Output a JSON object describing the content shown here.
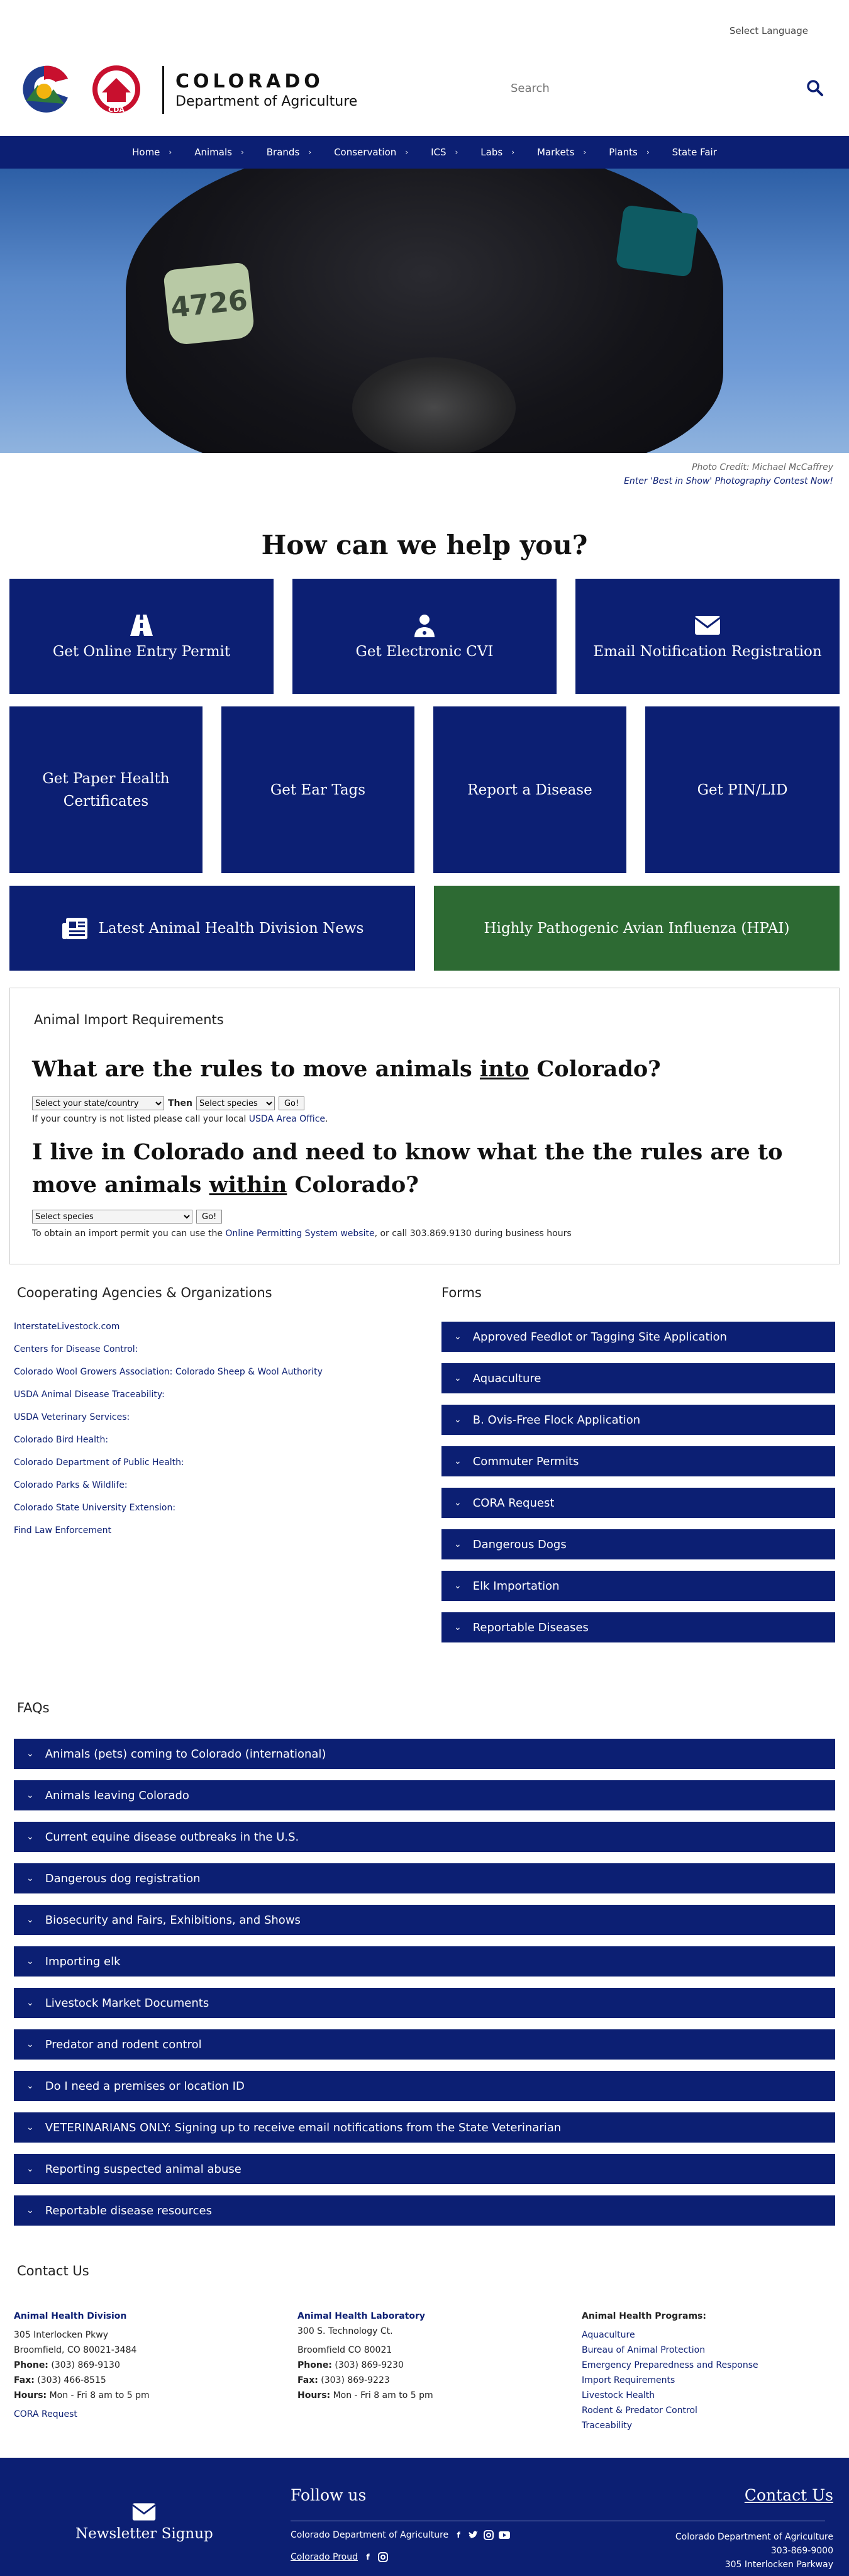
{
  "header": {
    "language": "Select Language",
    "logo_title": "COLORADO",
    "logo_sub": "Department of Agriculture",
    "logo_cda": "CDA",
    "search_placeholder": "Search"
  },
  "nav": [
    "Home",
    "Animals",
    "Brands",
    "Conservation",
    "ICS",
    "Labs",
    "Markets",
    "Plants",
    "State Fair"
  ],
  "hero": {
    "ear_tag": "4726",
    "credit": "Photo Credit: Michael McCaffrey",
    "contest_link": "Enter 'Best in Show' Photography Contest Now!"
  },
  "help_title": "How can we help you?",
  "tiles": {
    "entry_permit": "Get Online Entry Permit",
    "cvi": "Get Electronic CVI",
    "email": "Email Notification Registration",
    "paper": "Get Paper Health Certificates",
    "ear_tags": "Get Ear Tags",
    "report": "Report a Disease",
    "pin": "Get PIN/LID",
    "news": "Latest Animal Health Division News",
    "hpai": "Highly Pathogenic Avian Influenza (HPAI)"
  },
  "colors": {
    "navy": "#0c1f73",
    "green": "#2d6a33"
  },
  "import": {
    "heading": "Animal Import Requirements",
    "q1_pre": "What are the rules to move animals ",
    "q1_u": "into",
    "q1_post": " Colorado?",
    "state_select": "Select your state/country",
    "then": "Then",
    "species_select": "Select species",
    "go": "Go!",
    "note1_pre": "If your country is not listed please call your local ",
    "note1_link": "USDA Area Office",
    "note1_post": ".",
    "q2_pre": "I live in Colorado and need to know what the the rules are to move animals ",
    "q2_u": "within",
    "q2_post": " Colorado?",
    "note2_pre": "To obtain an import permit you can use the ",
    "note2_link": "Online Permitting System website",
    "note2_post": ", or call 303.869.9130 during business hours"
  },
  "agencies": {
    "heading": "Cooperating Agencies & Organizations",
    "links": [
      "InterstateLivestock.com",
      "Centers for Disease Control:",
      "Colorado Wool Growers Association: Colorado Sheep & Wool Authority",
      "USDA Animal Disease Traceability:",
      "USDA Veterinary Services:",
      "Colorado Bird Health:",
      "Colorado Department of Public Health:",
      "Colorado Parks & Wildlife:",
      "Colorado State University Extension:",
      "Find Law Enforcement"
    ]
  },
  "forms": {
    "heading": "Forms",
    "items": [
      "Approved Feedlot or Tagging Site Application",
      "Aquaculture",
      "B. Ovis-Free Flock Application",
      "Commuter Permits",
      "CORA Request",
      "Dangerous Dogs",
      "Elk Importation",
      "Reportable Diseases"
    ]
  },
  "faqs": {
    "heading": "FAQs",
    "items": [
      "Animals (pets) coming to Colorado (international)",
      "Animals leaving Colorado",
      "Current equine disease outbreaks in the U.S.",
      "Dangerous dog registration",
      "Biosecurity and Fairs, Exhibitions, and Shows",
      "Importing elk",
      "Livestock Market Documents",
      "Predator and rodent control",
      "Do I need a premises or location ID",
      "VETERINARIANS ONLY: Signing up to receive email notifications from the State Veterinarian",
      "Reporting suspected animal abuse",
      "Reportable disease resources"
    ]
  },
  "contact": {
    "heading": "Contact Us",
    "division": {
      "name": "Animal Health Division",
      "addr1": "305 Interlocken Pkwy",
      "addr2": "Broomfield, CO 80021-3484",
      "phone_label": "Phone:",
      "phone": "(303) 869-9130",
      "fax_label": "Fax:",
      "fax": "(303) 466-8515",
      "hours_label": "Hours:",
      "hours": "Mon - Fri 8 am to 5 pm",
      "cora": "CORA Request"
    },
    "lab": {
      "name": "Animal Health Laboratory",
      "addr1": "300 S. Technology Ct.",
      "addr2": "Broomfield CO 80021",
      "phone_label": "Phone:",
      "phone": "(303) 869-9230",
      "fax_label": "Fax:",
      "fax": "(303) 869-9223",
      "hours_label": "Hours:",
      "hours": "Mon - Fri 8 am to 5 pm"
    },
    "programs": {
      "heading": "Animal Health Programs:",
      "links": [
        "Aquaculture",
        "Bureau of Animal Protection",
        "Emergency Preparedness and Response",
        "Import Requirements",
        "Livestock Health",
        "Rodent & Predator Control",
        "Traceability"
      ]
    }
  },
  "footer": {
    "newsletter": "Newsletter Signup",
    "follow": "Follow us",
    "cda": "Colorado Department of Agriculture",
    "proud": "Colorado Proud",
    "contact_link": "Contact Us",
    "addr_name": "Colorado Department of Agriculture",
    "phone": "303-869-9000",
    "addr": "305 Interlocken Parkway"
  }
}
